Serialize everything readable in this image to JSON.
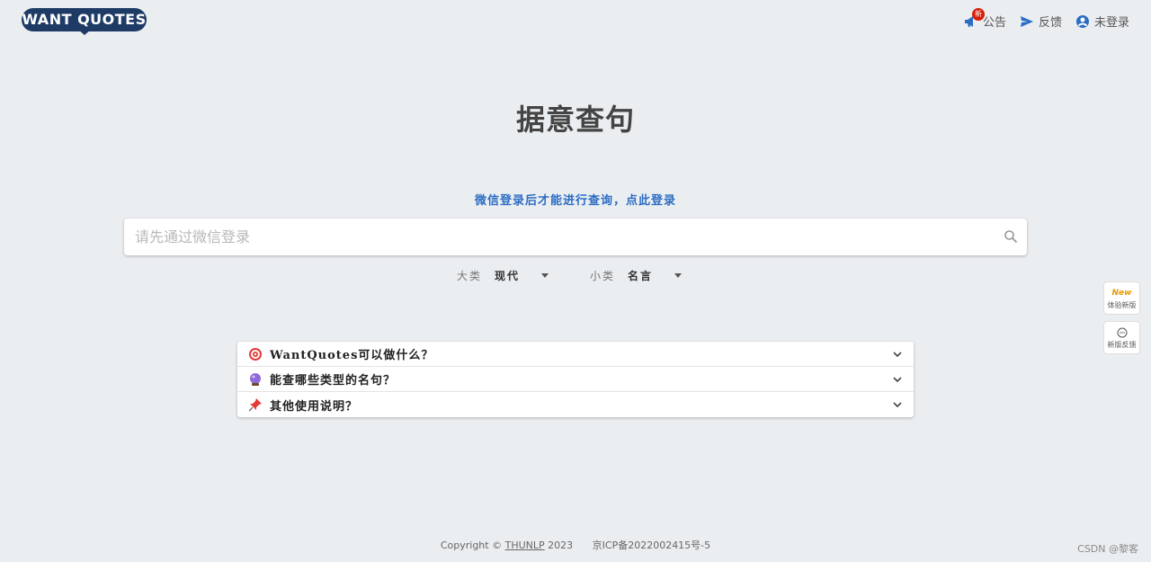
{
  "header": {
    "logo_text": "WANT QUOTES",
    "nav": {
      "announce_label": "公告",
      "announce_badge": "新",
      "feedback_label": "反馈",
      "login_label": "未登录"
    }
  },
  "main": {
    "title": "据意查句",
    "login_prompt": "微信登录后才能进行查询，点此登录",
    "search": {
      "placeholder": "请先通过微信登录",
      "value": ""
    },
    "filters": {
      "major_label": "大类",
      "major_value": "现代",
      "minor_label": "小类",
      "minor_value": "名言"
    },
    "faq": [
      {
        "icon": "target-icon",
        "text": "WantQuotes可以做什么？"
      },
      {
        "icon": "crystal-ball-icon",
        "text": "能查哪些类型的名句？"
      },
      {
        "icon": "pushpin-icon",
        "text": "其他使用说明？"
      }
    ]
  },
  "side": {
    "new_tag": "New",
    "try_new_label": "体验新版",
    "feedback_new_label": "新版反馈"
  },
  "footer": {
    "copyright_prefix": "Copyright ©",
    "org_link": "THUNLP",
    "year": "2023",
    "icp": "京ICP备2022002415号-5"
  },
  "watermark": "CSDN @黎客",
  "colors": {
    "accent": "#2b6cc4",
    "logo_bg": "#1e3b66",
    "badge": "#d81e06",
    "background": "#ebeef1"
  }
}
